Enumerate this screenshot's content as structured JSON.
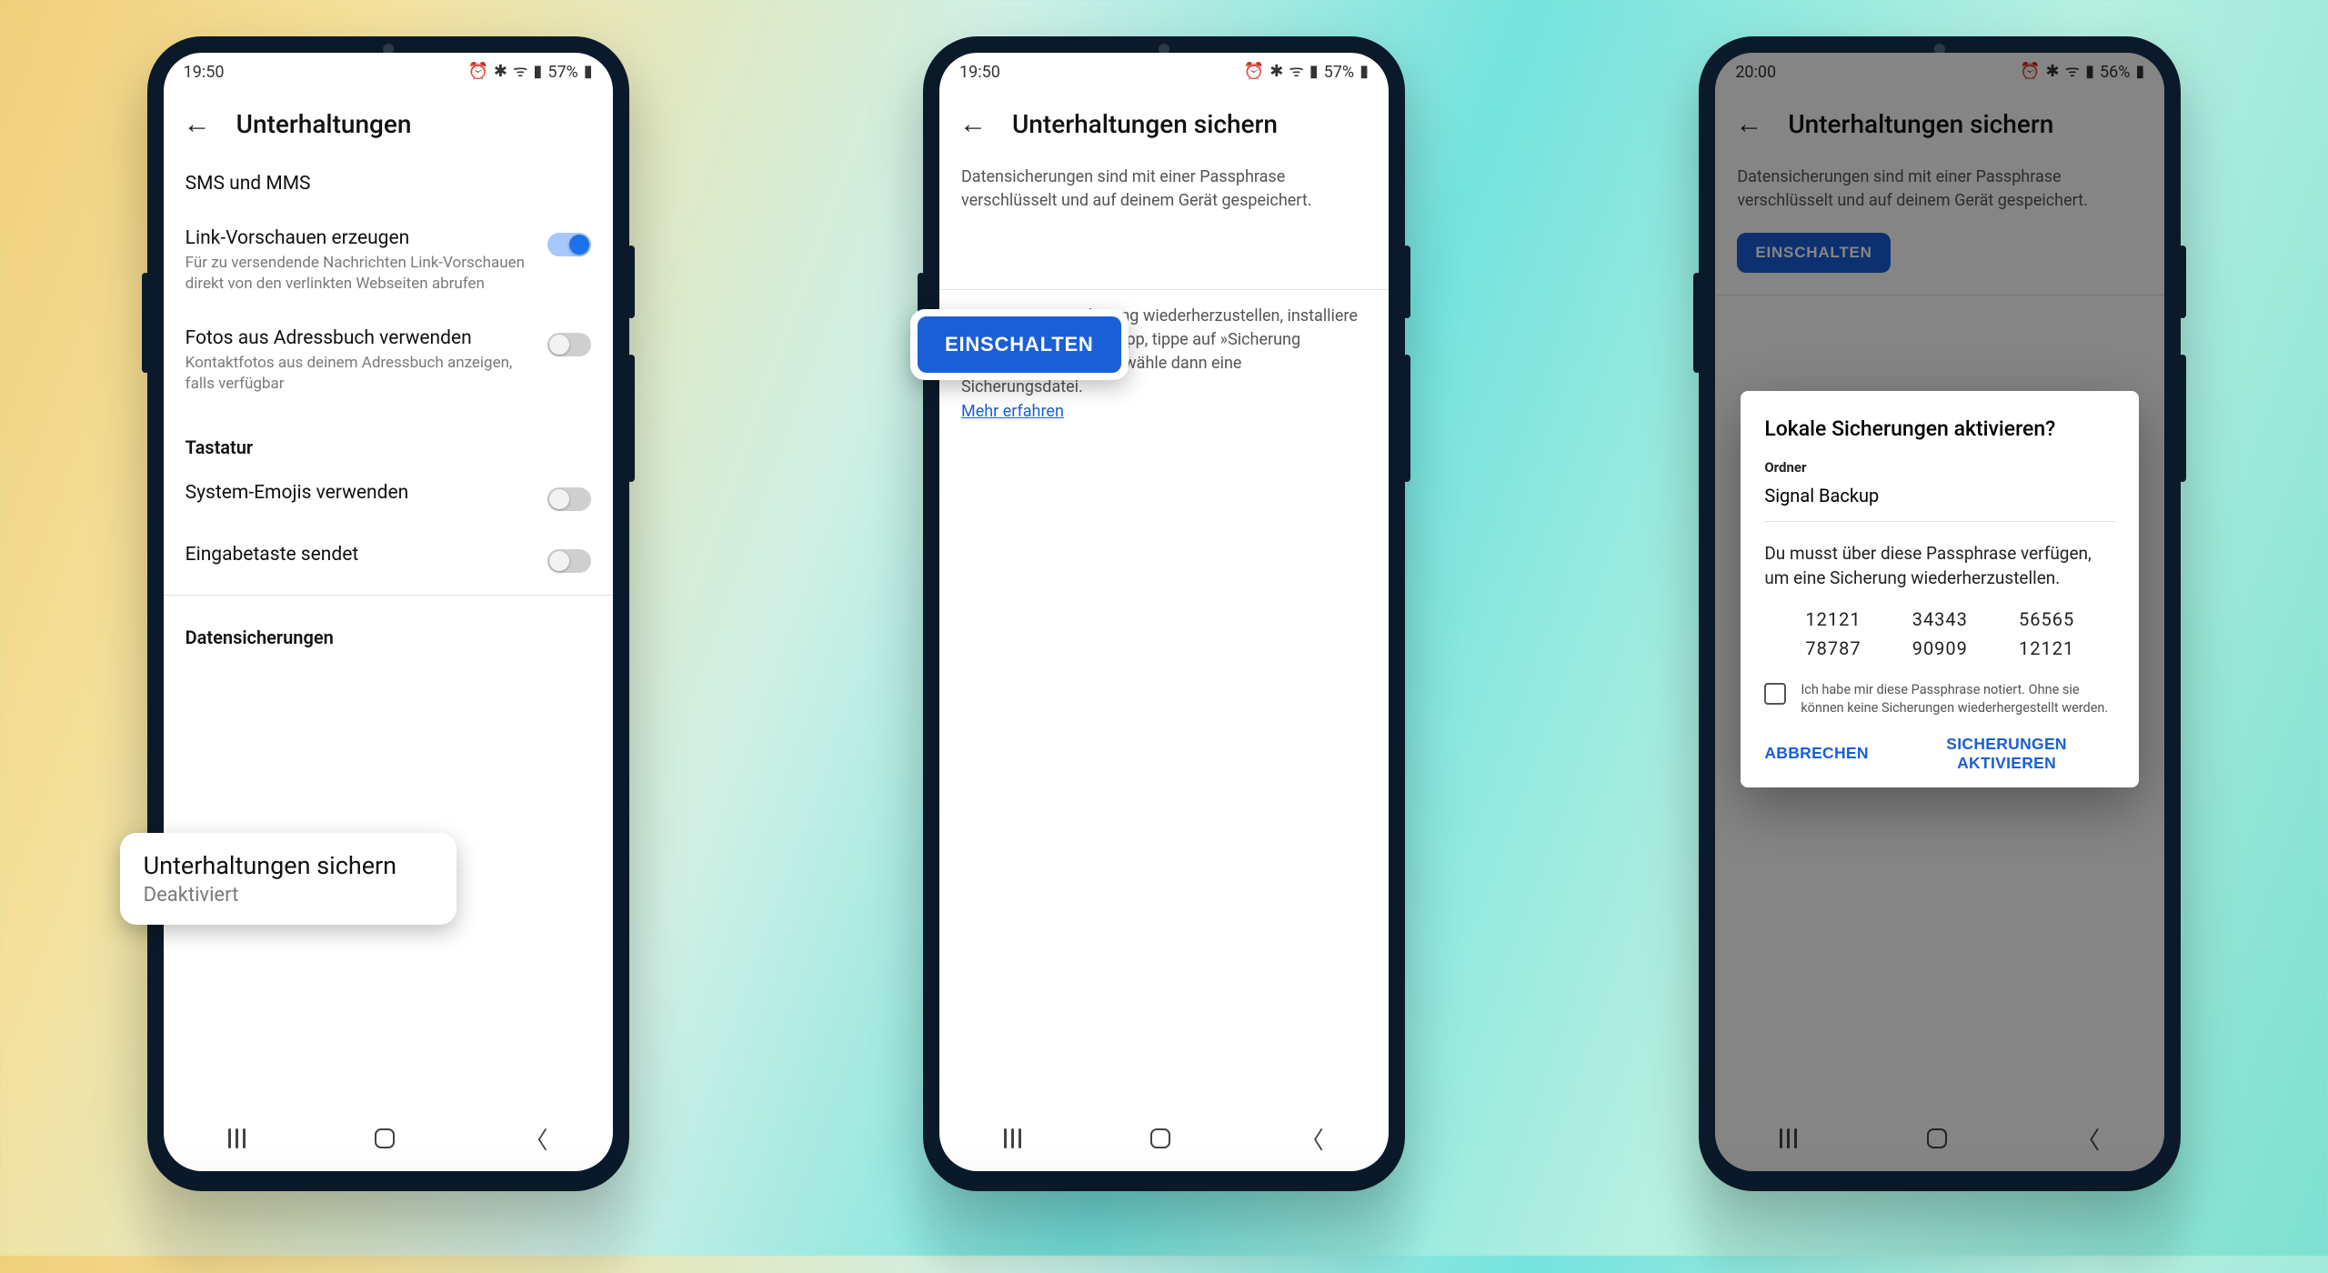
{
  "s1": {
    "status": {
      "time": "19:50",
      "battery": "57%"
    },
    "title": "Unterhaltungen",
    "rows": {
      "sms": {
        "title": "SMS und MMS"
      },
      "link": {
        "title": "Link-Vorschauen erzeugen",
        "sub": "Für zu versendende Nachrichten Link-Vorschauen direkt von den verlinkten Webseiten abrufen"
      },
      "photos": {
        "title": "Fotos aus Adressbuch verwenden",
        "sub": "Kontaktfotos aus deinem Adressbuch anzeigen, falls verfügbar"
      },
      "keyboard_h": "Tastatur",
      "emoji": {
        "title": "System-Emojis verwenden"
      },
      "enter": {
        "title": "Eingabetaste sendet"
      },
      "backup_h": "Datensicherungen",
      "backup": {
        "title": "Unterhaltungen sichern",
        "sub": "Deaktiviert"
      }
    }
  },
  "s2": {
    "status": {
      "time": "19:50",
      "battery": "57%"
    },
    "title": "Unterhaltungen sichern",
    "p1": "Datensicherungen sind mit einer Passphrase verschlüsselt und auf deinem Gerät gespeichert.",
    "button": "EINSCHALTEN",
    "p2a": "Um eine Datensicherung wiederherzustellen, installiere Signal neu. Öffne die App, tippe auf »Sicherung wiederherstellen« und wähle dann eine Sicherungsdatei.",
    "p2_link": "Mehr erfahren"
  },
  "s3": {
    "status": {
      "time": "20:00",
      "battery": "56%"
    },
    "title": "Unterhaltungen sichern",
    "p1": "Datensicherungen sind mit einer Passphrase verschlüsselt und auf deinem Gerät gespeichert.",
    "button": "EINSCHALTEN",
    "dialog": {
      "title": "Lokale Sicherungen aktivieren?",
      "folder_label": "Ordner",
      "folder": "Signal Backup",
      "note": "Du musst über diese Passphrase verfügen, um eine Sicherung wiederherzustellen.",
      "pass": [
        "12121",
        "34343",
        "56565",
        "78787",
        "90909",
        "12121"
      ],
      "check": "Ich habe mir diese Passphrase notiert. Ohne sie können keine Sicherungen wiederhergestellt werden.",
      "cancel": "ABBRECHEN",
      "confirm": "SICHERUNGEN AKTIVIEREN"
    }
  }
}
